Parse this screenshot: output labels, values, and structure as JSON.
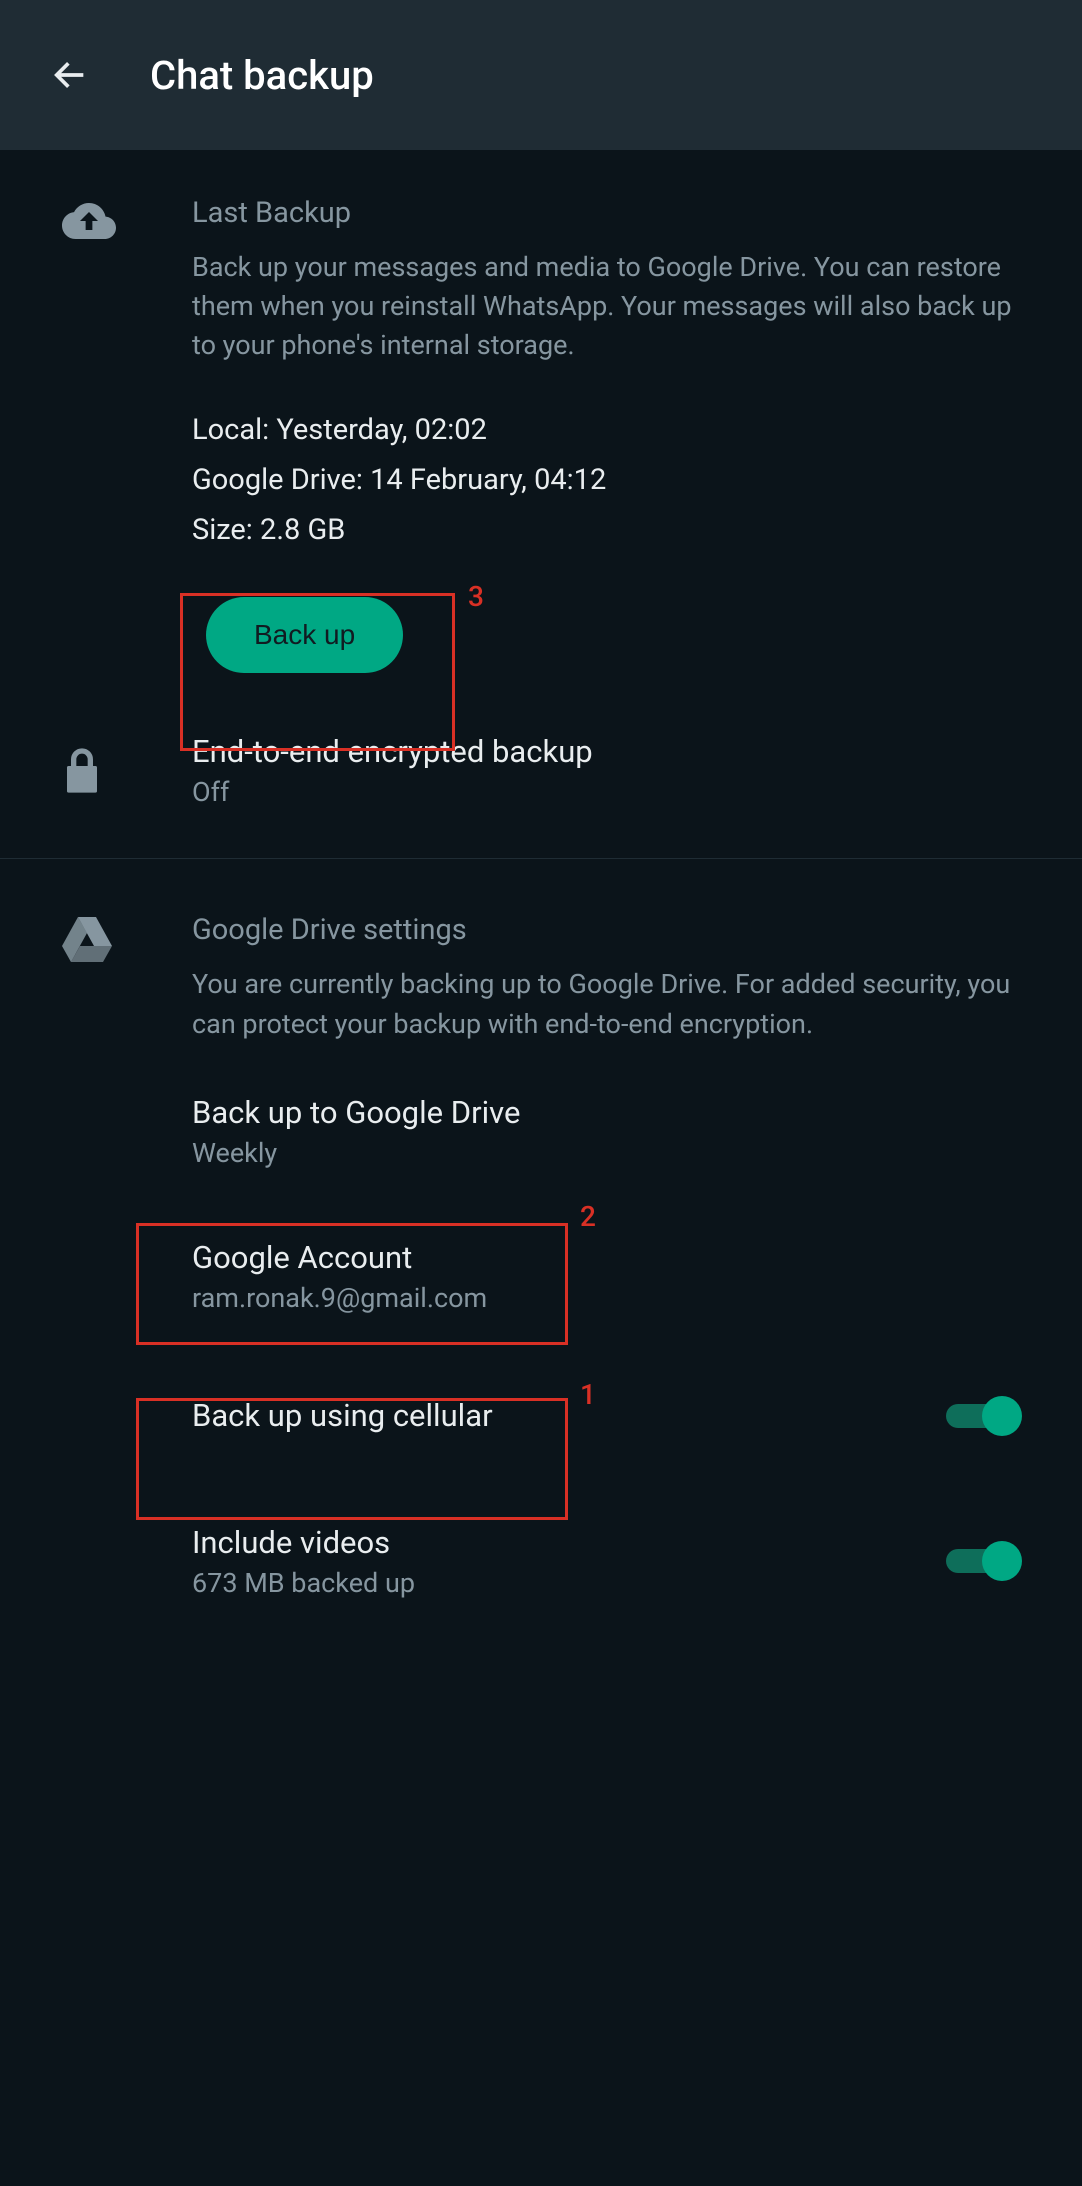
{
  "header": {
    "title": "Chat backup"
  },
  "last_backup": {
    "heading": "Last Backup",
    "description": "Back up your messages and media to Google Drive. You can restore them when you reinstall WhatsApp. Your messages will also back up to your phone's internal storage.",
    "local_line": "Local: Yesterday, 02:02",
    "drive_line": "Google Drive: 14 February, 04:12",
    "size_line": "Size: 2.8 GB",
    "button_label": "Back up"
  },
  "e2e": {
    "title": "End-to-end encrypted backup",
    "status": "Off"
  },
  "drive": {
    "heading": "Google Drive settings",
    "description": "You are currently backing up to Google Drive. For added security, you can protect your backup with end-to-end encryption.",
    "freq_title": "Back up to Google Drive",
    "freq_value": "Weekly",
    "account_title": "Google Account",
    "account_value": "ram.ronak.9@gmail.com",
    "cellular_title": "Back up using cellular",
    "videos_title": "Include videos",
    "videos_sub": "673 MB backed up"
  },
  "annotations": {
    "a1": "1",
    "a2": "2",
    "a3": "3"
  }
}
